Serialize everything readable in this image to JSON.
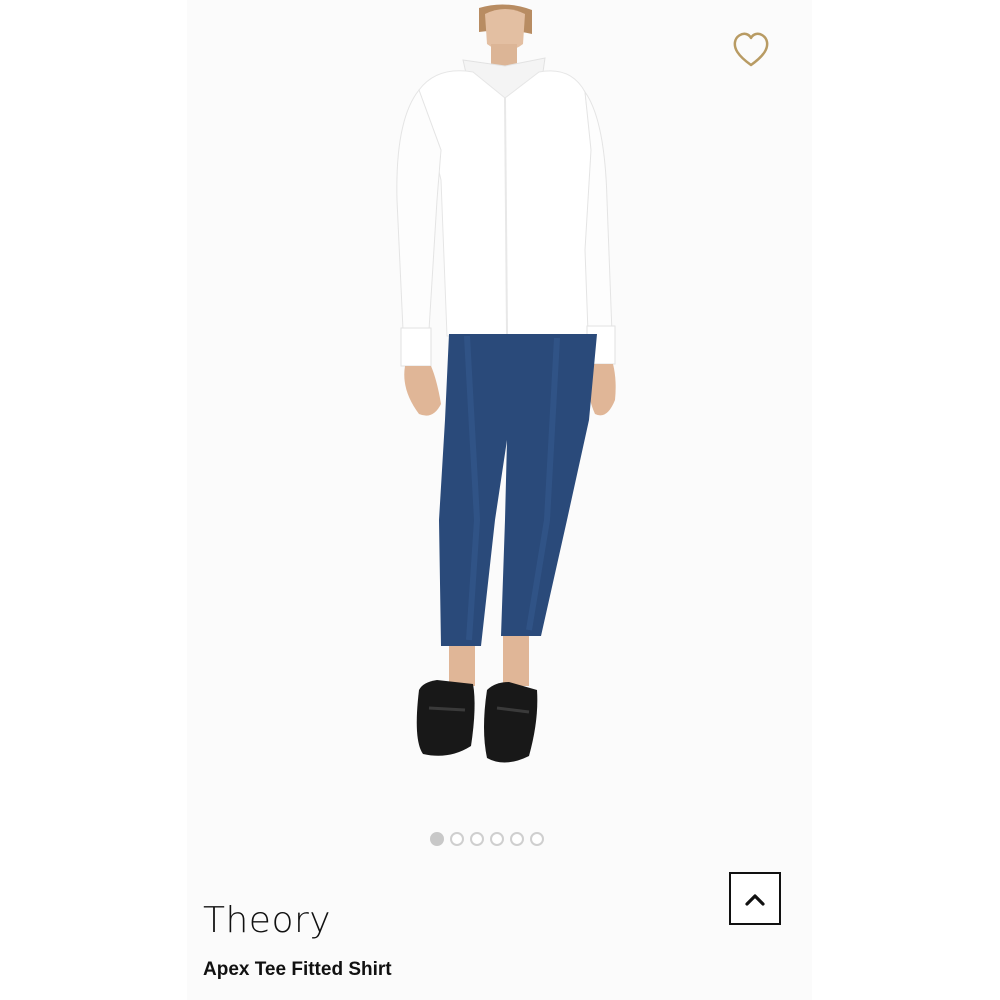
{
  "product": {
    "brand": "Theory",
    "name": "Apex Tee Fitted Shirt",
    "image_alt": "Model wearing white fitted shirt with dark blue skinny jeans and black loafers"
  },
  "gallery": {
    "total_images": 6,
    "active_index": 0
  },
  "icons": {
    "favorite": "heart-outline-icon",
    "scroll_top": "chevron-up-icon"
  },
  "colors": {
    "accent_gold": "#b89b63",
    "text": "#111111",
    "dot_inactive": "#cfcfcf",
    "dot_active": "#c8c8c8"
  }
}
